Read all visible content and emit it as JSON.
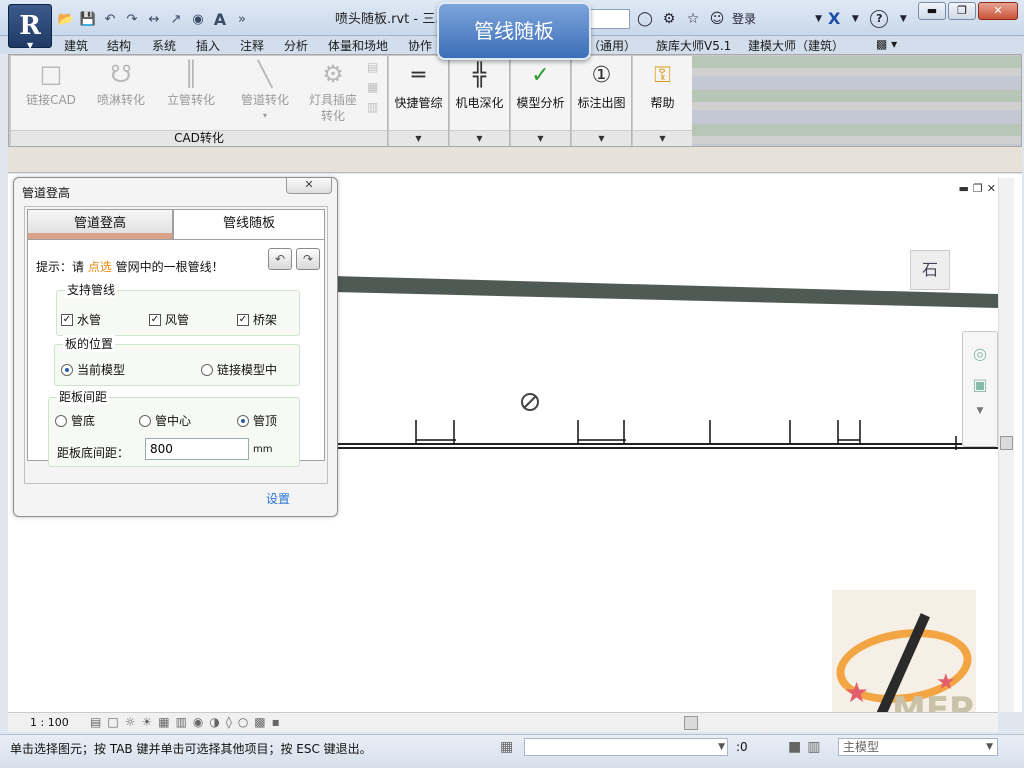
{
  "app": {
    "logo": "R",
    "document_title": "喷头随板.rvt - 三...",
    "quick_access": [
      "open-icon",
      "save-icon",
      "undo-icon",
      "redo-icon",
      "measure-icon",
      "dimension-icon",
      "tag-icon",
      "text-icon"
    ],
    "text_tool": "A",
    "login_label": "登录",
    "help_label": "?"
  },
  "balloon": {
    "text": "管线随板"
  },
  "ribbon_tabs": [
    "建筑",
    "结构",
    "系统",
    "插入",
    "注释",
    "分析",
    "体量和场地",
    "协作",
    "（通用）",
    "族库大师V5.1",
    "建模大师（建筑）"
  ],
  "ribbon": {
    "cad_group": {
      "label": "CAD转化",
      "buttons": [
        "链接CAD",
        "喷淋转化",
        "立管转化",
        "管道转化",
        "灯具插座转化"
      ]
    },
    "tools": [
      "快捷管综",
      "机电深化",
      "模型分析",
      "标注出图",
      "帮助"
    ]
  },
  "dialog": {
    "title": "管道登高",
    "close": "✕",
    "tabs": [
      "管道登高",
      "管线随板"
    ],
    "active_tab": "管线随板",
    "hint_prefix": "提示：请 ",
    "hint_highlight": "点选",
    "hint_suffix": " 管网中的一根管线！",
    "support": {
      "legend": "支持管线",
      "items": [
        {
          "label": "水管",
          "checked": true
        },
        {
          "label": "风管",
          "checked": true
        },
        {
          "label": "桥架",
          "checked": true
        }
      ]
    },
    "position": {
      "legend": "板的位置",
      "options": [
        {
          "label": "当前模型",
          "selected": true
        },
        {
          "label": "链接模型中",
          "selected": false
        }
      ]
    },
    "spacing": {
      "legend": "距板间距",
      "options": [
        {
          "label": "管底",
          "selected": false
        },
        {
          "label": "管中心",
          "selected": false
        },
        {
          "label": "管顶",
          "selected": true
        }
      ],
      "field_label": "距板底间距：",
      "value": "800",
      "unit": "mm"
    },
    "settings_link": "设置"
  },
  "canvas": {
    "section_tag": "石"
  },
  "view_bar": {
    "scale": "1 : 100"
  },
  "watermark": {
    "text": "MEP"
  },
  "status": {
    "message": "单击选择图元；按 TAB 键并单击可选择其他项目；按 ESC 键退出。",
    "selection_count": ":0",
    "model": "主模型"
  }
}
